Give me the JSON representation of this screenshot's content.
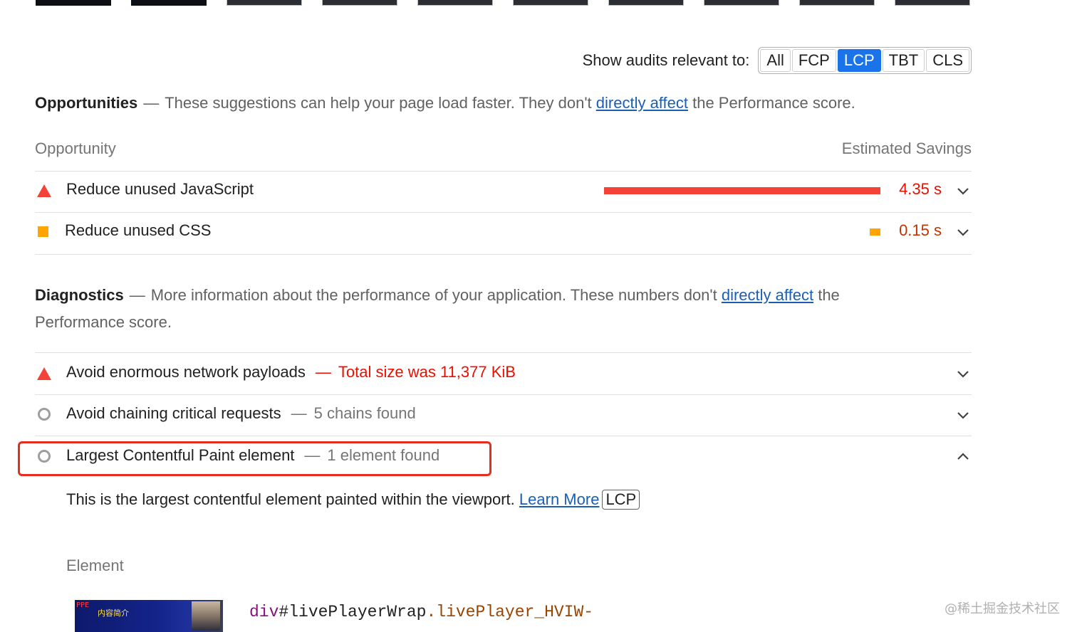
{
  "filter": {
    "label": "Show audits relevant to:",
    "options": [
      "All",
      "FCP",
      "LCP",
      "TBT",
      "CLS"
    ],
    "selected": "LCP"
  },
  "opportunities": {
    "title": "Opportunities",
    "desc_pre": "These suggestions can help your page load faster. They don't",
    "link": "directly affect",
    "desc_post": "the Performance score.",
    "col_left": "Opportunity",
    "col_right": "Estimated Savings",
    "items": [
      {
        "label": "Reduce unused JavaScript",
        "savings": "4.35 s",
        "status": "fail",
        "color": "#eb0f00"
      },
      {
        "label": "Reduce unused CSS",
        "savings": "0.15 s",
        "status": "average",
        "color": "#c33300"
      }
    ]
  },
  "diagnostics": {
    "title": "Diagnostics",
    "desc_pre": "More information about the performance of your application. These numbers don't",
    "link": "directly affect",
    "desc_post": "the",
    "desc_line2": "Performance score.",
    "items": [
      {
        "label": "Avoid enormous network payloads",
        "detail": "Total size was 11,377 KiB",
        "status": "fail"
      },
      {
        "label": "Avoid chaining critical requests",
        "detail": "5 chains found",
        "status": "info"
      },
      {
        "label": "Largest Contentful Paint element",
        "detail": "1 element found",
        "status": "info",
        "expanded": true
      }
    ]
  },
  "lcp_detail": {
    "description": "This is the largest contentful element painted within the viewport.",
    "learn_more": "Learn More",
    "badge": "LCP",
    "column": "Element",
    "selector_tag": "div",
    "selector_id": "#livePlayerWrap",
    "selector_class": ".livePlayer_HVIW-",
    "thumb_text_1": "PPE",
    "thumb_text_2": "内容简介"
  },
  "watermark": "@稀土掘金技术社区",
  "colors": {
    "fail": "#f44336",
    "average": "#ffa400",
    "info": "#9e9e9e",
    "accent": "#1a73e8",
    "highlight": "#e62e1f"
  }
}
